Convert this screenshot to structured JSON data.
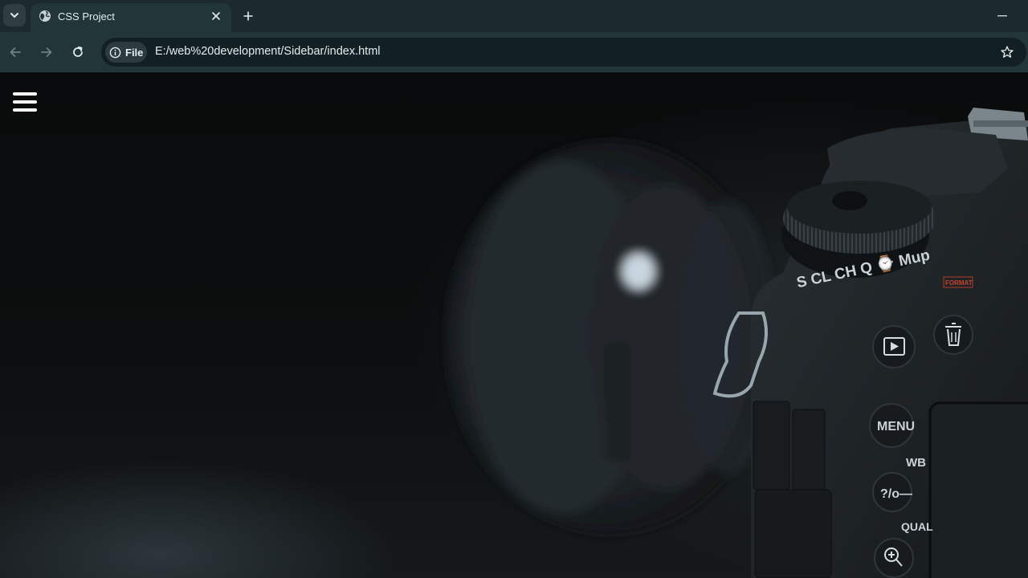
{
  "browser": {
    "tab": {
      "title": "CSS Project"
    },
    "address_bar": {
      "chip_label": "File",
      "url": "E:/web%20development/Sidebar/index.html"
    }
  },
  "page": {
    "camera_labels": {
      "dial_modes": "S  CL CH  Q  ⌚ Mup",
      "menu": "MENU",
      "wb": "WB",
      "help": "?/o—",
      "qual": "QUAL",
      "format": "FORMAT"
    }
  },
  "icons": {
    "tab_search": "chevron-down-icon",
    "favicon": "globe-icon",
    "close": "close-icon",
    "new_tab": "plus-icon",
    "back": "arrow-left-icon",
    "forward": "arrow-right-icon",
    "reload": "reload-icon",
    "info": "info-icon",
    "bookmark": "star-icon",
    "menu": "hamburger-icon"
  }
}
